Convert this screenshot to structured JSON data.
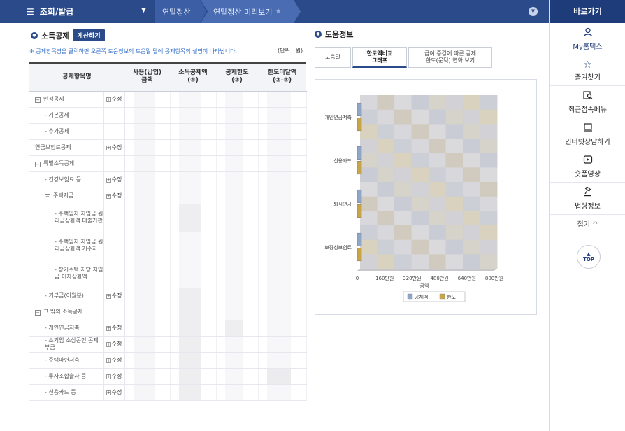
{
  "topbar": {
    "menu_label": "조회/발급",
    "crumb1": "연말정산",
    "crumb2": "연말정산 미리보기"
  },
  "right": {
    "title": "바로가기",
    "items": [
      {
        "label": "My홈택스"
      },
      {
        "label": "즐겨찾기"
      },
      {
        "label": "최근접속메뉴"
      },
      {
        "label": "인터넷상담하기"
      },
      {
        "label": "숏폼영상"
      },
      {
        "label": "법령정보"
      }
    ],
    "fold": "접기 ^",
    "top": "TOP"
  },
  "left": {
    "title": "소득공제",
    "calc_button": "계산하기",
    "notice": "※ 공제항목명을 클릭하면 오른쪽 도움정보의 도움말 탭에 공제항목의 설명이 나타납니다.",
    "unit": "(단위 : 원)",
    "columns": [
      "공제항목명",
      "사용(납입)\n금액",
      "소득공제액\n(①)",
      "공제한도\n(②)",
      "한도미달액\n(②-①)"
    ],
    "edit_label": "수정",
    "rows": [
      {
        "name": "인적공제",
        "box": "−",
        "edit": true,
        "level": 0
      },
      {
        "name": "- 기본공제",
        "edit": false,
        "level": 1
      },
      {
        "name": "- 추가공제",
        "edit": false,
        "level": 1
      },
      {
        "name": "연금보험료공제",
        "edit": true,
        "level": 0
      },
      {
        "name": "특별소득공제",
        "box": "−",
        "edit": false,
        "level": 0
      },
      {
        "name": "- 건강보험료 등",
        "edit": true,
        "level": 1
      },
      {
        "name": "주택자금",
        "box": "−",
        "edit": true,
        "level": 1
      },
      {
        "name": "- 주택임차 차입금 원리금상환액 대출기관",
        "edit": false,
        "level": 2
      },
      {
        "name": "- 주택임차 차입금 원리금상환액 거주자",
        "edit": false,
        "level": 2
      },
      {
        "name": "- 장기주택 저당 차입금 이자상환액",
        "edit": false,
        "level": 2
      },
      {
        "name": "- 기부금(이월분)",
        "edit": true,
        "level": 1
      },
      {
        "name": "그 밖의 소득공제",
        "box": "−",
        "edit": false,
        "level": 0
      },
      {
        "name": "- 개인연금저축",
        "edit": true,
        "level": 1
      },
      {
        "name": "- 소기업 소상공인 공제부금",
        "edit": true,
        "level": 1
      },
      {
        "name": "- 주택마련저축",
        "edit": true,
        "level": 1
      },
      {
        "name": "- 투자조합출자 등",
        "edit": true,
        "level": 1
      },
      {
        "name": "- 신용카드 등",
        "edit": true,
        "level": 1
      }
    ]
  },
  "help": {
    "title": "도움정보",
    "tabs": [
      "도움말",
      "한도액비교\n그래프",
      "급여 증감에 따른 공제\n한도(문턱) 변화 보기"
    ]
  },
  "chart_data": {
    "type": "bar",
    "orientation": "horizontal",
    "categories": [
      "개인연금저축",
      "신용카드",
      "퇴직연금",
      "보장성보험료"
    ],
    "x_ticks": [
      "0",
      "160만원",
      "320만원",
      "480만원",
      "640만원",
      "800만원"
    ],
    "xlabel": "금액",
    "xlim": [
      0,
      800
    ],
    "series": [
      {
        "name": "공제액",
        "values": [
          0,
          0,
          0,
          0
        ],
        "color": "#8fa6c8"
      },
      {
        "name": "한도",
        "values": [
          0,
          0,
          0,
          0
        ],
        "color": "#c9a54a"
      }
    ],
    "legend": "bottom"
  }
}
